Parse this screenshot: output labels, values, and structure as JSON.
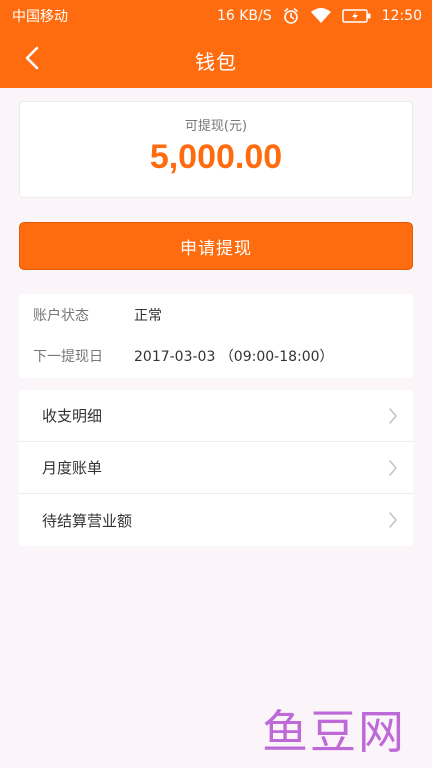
{
  "status_bar": {
    "carrier": "中国移动",
    "network_speed": "16 KB/S",
    "time": "12:50",
    "icons": [
      "alarm-icon",
      "wifi-icon",
      "battery-charging-icon"
    ]
  },
  "nav": {
    "title": "钱包",
    "back_icon": "chevron-left-icon"
  },
  "balance": {
    "label": "可提现(元)",
    "amount": "5,000.00"
  },
  "withdraw_button": {
    "label": "申请提现"
  },
  "info": {
    "account_status_label": "账户状态",
    "account_status_value": "正常",
    "next_withdraw_label": "下一提现日",
    "next_withdraw_value": "2017-03-03 （09:00-18:00）"
  },
  "menu": {
    "items": [
      {
        "label": "收支明细",
        "icon": "chevron-right-icon"
      },
      {
        "label": "月度账单",
        "icon": "chevron-right-icon"
      },
      {
        "label": "待结算营业额",
        "icon": "chevron-right-icon"
      }
    ]
  },
  "watermark": {
    "text": "鱼豆网"
  },
  "colors": {
    "accent": "#fe6c0f",
    "background": "#fbf5f9",
    "watermark": "#b85fd6"
  }
}
